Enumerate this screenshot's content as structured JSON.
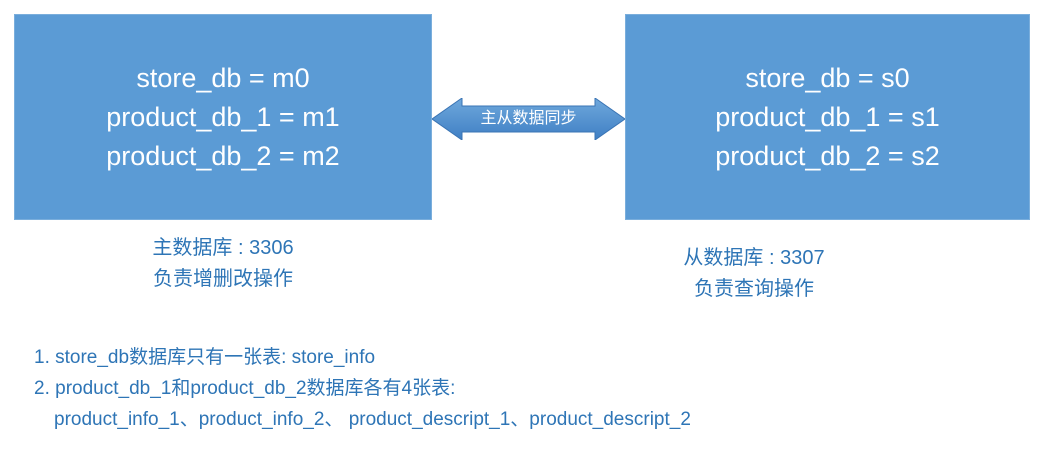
{
  "master": {
    "lines": [
      "store_db = m0",
      "product_db_1 = m1",
      "product_db_2 = m2"
    ],
    "caption_port": "主数据库 : 3306",
    "caption_role": "负责增删改操作"
  },
  "sync": {
    "label": "主从数据同步"
  },
  "slave": {
    "lines": [
      "store_db = s0",
      "product_db_1 = s1",
      "product_db_2 = s2"
    ],
    "caption_port": "从数据库 : 3307",
    "caption_role": "负责查询操作"
  },
  "notes": [
    "1. store_db数据库只有一张表: store_info",
    "2. product_db_1和product_db_2数据库各有4张表:",
    "product_info_1、product_info_2、 product_descript_1、product_descript_2"
  ],
  "colors": {
    "box_fill": "#5b9bd5",
    "caption_text": "#2e75b6",
    "arrow_fill": "#4a86c8"
  }
}
